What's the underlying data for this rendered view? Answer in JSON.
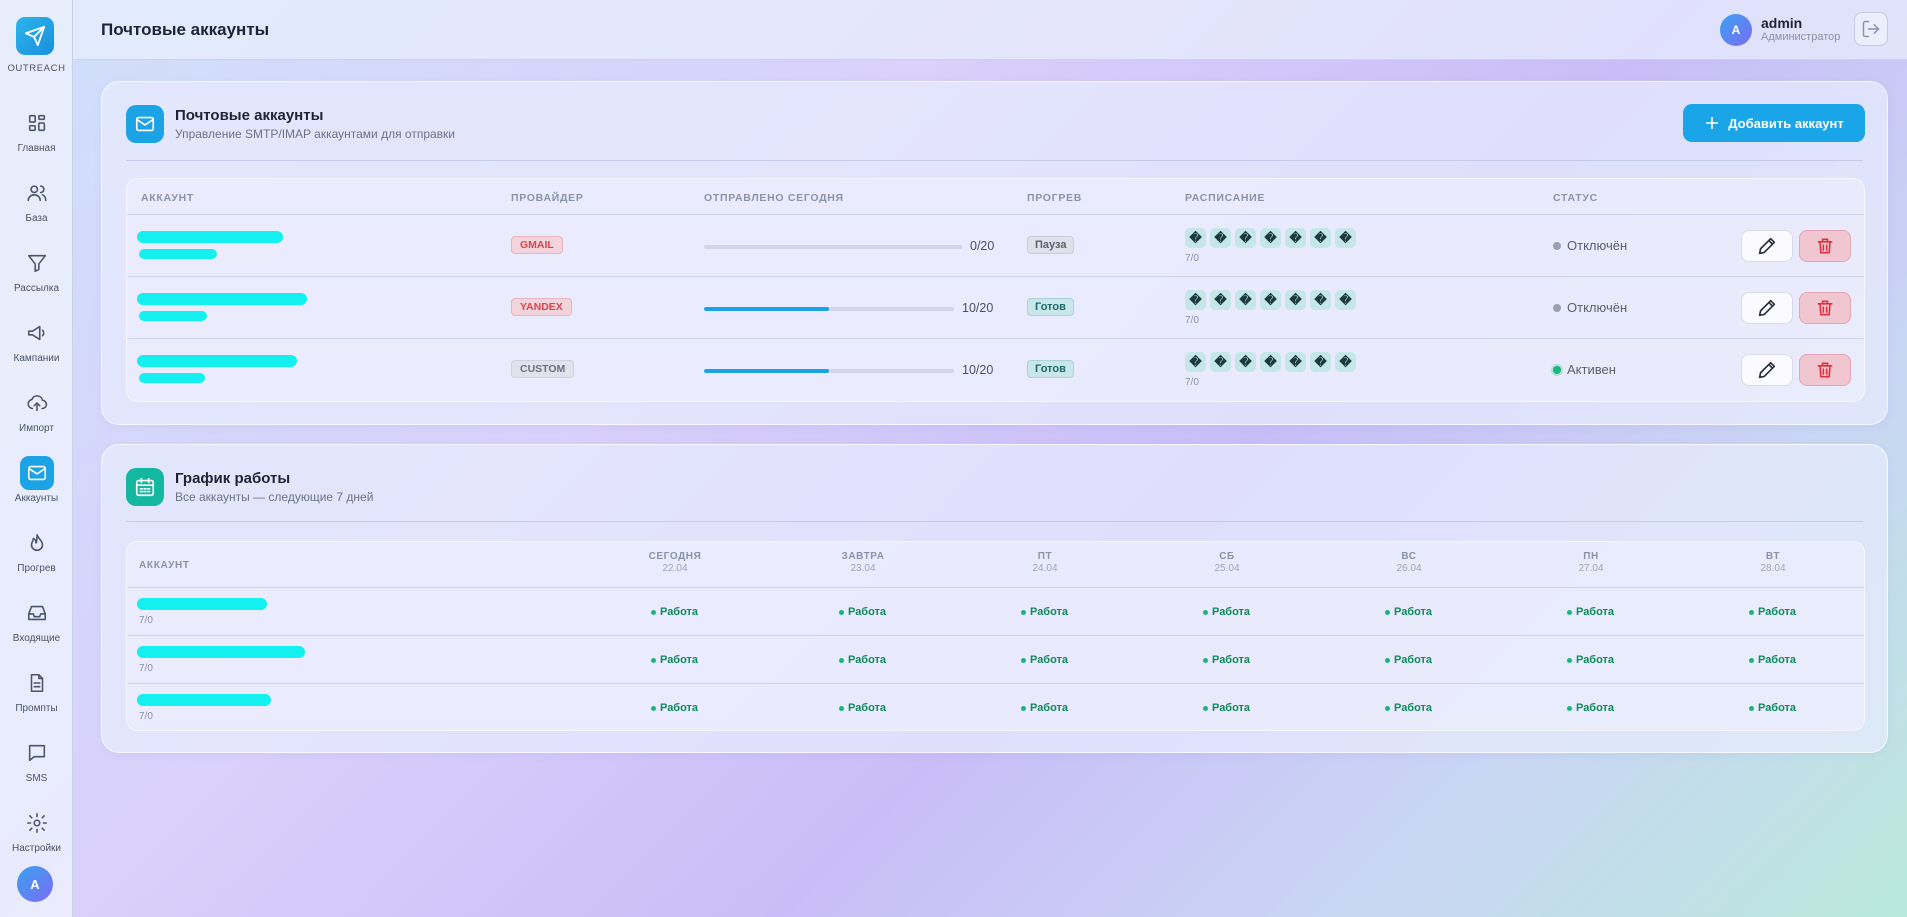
{
  "brand": {
    "name": "OUTREACH"
  },
  "nav": [
    {
      "label": "Главная",
      "icon": "dashboard-icon"
    },
    {
      "label": "База",
      "icon": "users-icon"
    },
    {
      "label": "Рассылка",
      "icon": "funnel-icon"
    },
    {
      "label": "Кампании",
      "icon": "megaphone-icon"
    },
    {
      "label": "Импорт",
      "icon": "upload-cloud-icon"
    },
    {
      "label": "Аккаунты",
      "icon": "mail-icon",
      "active": true
    },
    {
      "label": "Прогрев",
      "icon": "flame-icon"
    },
    {
      "label": "Входящие",
      "icon": "inbox-icon"
    },
    {
      "label": "Промпты",
      "icon": "document-icon"
    },
    {
      "label": "SMS",
      "icon": "chat-icon"
    },
    {
      "label": "Настройки",
      "icon": "gear-icon"
    }
  ],
  "sidebar_avatar": "A",
  "topbar": {
    "title": "Почтовые аккаунты"
  },
  "user": {
    "initial": "A",
    "name": "admin",
    "role": "Администратор"
  },
  "accounts_card": {
    "title": "Почтовые аккаунты",
    "subtitle": "Управление SMTP/IMAP аккаунтами для отправки",
    "add_button": "Добавить аккаунт",
    "columns": [
      "АККАУНТ",
      "ПРОВАЙДЕР",
      "ОТПРАВЛЕНО СЕГОДНЯ",
      "ПРОГРЕВ",
      "РАСПИСАНИЕ",
      "СТАТУС"
    ],
    "rows": [
      {
        "provider": "GMAIL",
        "provider_style": "gmail",
        "sent": 0,
        "limit": 20,
        "sent_label": "0/20",
        "warmup": "Пауза",
        "warmup_style": "pause",
        "schedule_days": [
          "�",
          "�",
          "�",
          "�",
          "�",
          "�",
          "�"
        ],
        "schedule_count": "7/0",
        "status": "Отключён",
        "active": false
      },
      {
        "provider": "YANDEX",
        "provider_style": "yandex",
        "sent": 10,
        "limit": 20,
        "sent_label": "10/20",
        "warmup": "Готов",
        "warmup_style": "ready",
        "schedule_days": [
          "�",
          "�",
          "�",
          "�",
          "�",
          "�",
          "�"
        ],
        "schedule_count": "7/0",
        "status": "Отключён",
        "active": false
      },
      {
        "provider": "CUSTOM",
        "provider_style": "custom",
        "sent": 10,
        "limit": 20,
        "sent_label": "10/20",
        "warmup": "Готов",
        "warmup_style": "ready",
        "schedule_days": [
          "�",
          "�",
          "�",
          "�",
          "�",
          "�",
          "�"
        ],
        "schedule_count": "7/0",
        "status": "Активен",
        "active": true
      }
    ]
  },
  "schedule_card": {
    "title": "График работы",
    "subtitle": "Все аккаунты — следующие 7 дней",
    "account_header": "АККАУНТ",
    "days": [
      {
        "name": "СЕГОДНЯ",
        "date": "22.04"
      },
      {
        "name": "ЗАВТРА",
        "date": "23.04"
      },
      {
        "name": "ПТ",
        "date": "24.04"
      },
      {
        "name": "СБ",
        "date": "25.04"
      },
      {
        "name": "ВС",
        "date": "26.04"
      },
      {
        "name": "ПН",
        "date": "27.04"
      },
      {
        "name": "ВТ",
        "date": "28.04"
      }
    ],
    "rows": [
      {
        "count": "7/0",
        "cells": [
          "Работа",
          "Работа",
          "Работа",
          "Работа",
          "Работа",
          "Работа",
          "Работа"
        ]
      },
      {
        "count": "7/0",
        "cells": [
          "Работа",
          "Работа",
          "Работа",
          "Работа",
          "Работа",
          "Работа",
          "Работа"
        ]
      },
      {
        "count": "7/0",
        "cells": [
          "Работа",
          "Работа",
          "Работа",
          "Работа",
          "Работа",
          "Работа",
          "Работа"
        ]
      }
    ]
  }
}
